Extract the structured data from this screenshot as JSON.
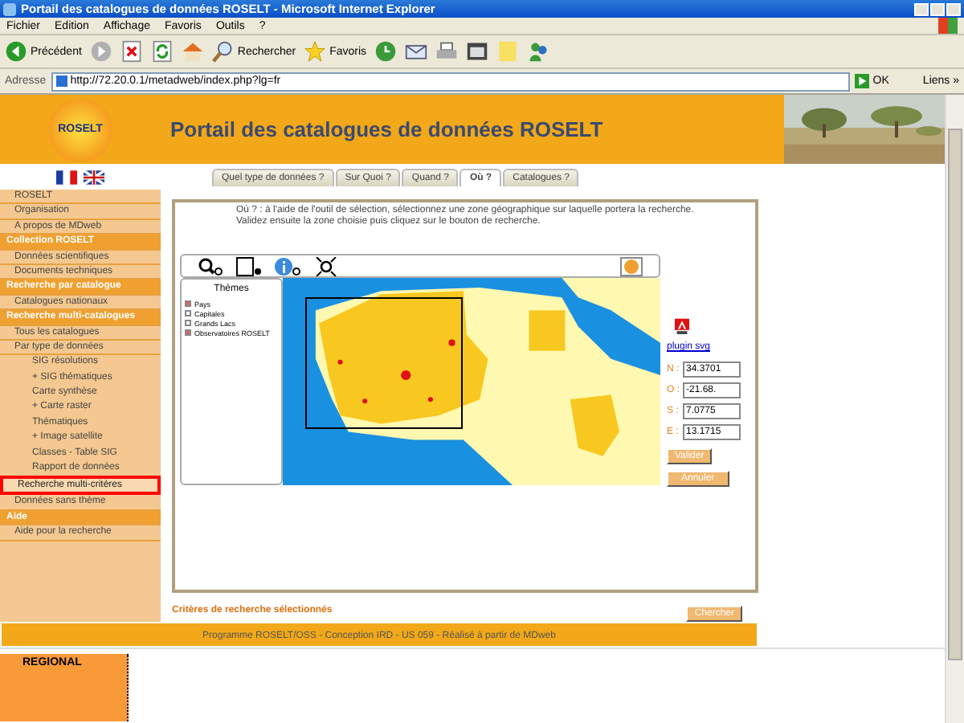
{
  "window": {
    "title": "Portail des catalogues de données ROSELT - Microsoft Internet Explorer"
  },
  "menu": [
    "Fichier",
    "Edition",
    "Affichage",
    "Favoris",
    "Outils",
    "?"
  ],
  "toolbar": [
    {
      "kind": "back",
      "label": "Précédent"
    },
    {
      "kind": "forward"
    },
    {
      "kind": "stop"
    },
    {
      "kind": "refresh"
    },
    {
      "kind": "home"
    },
    {
      "kind": "search",
      "label": "Rechercher"
    },
    {
      "kind": "favorites",
      "label": "Favoris"
    },
    {
      "kind": "history"
    },
    {
      "kind": "mail"
    },
    {
      "kind": "print"
    },
    {
      "kind": "edit"
    },
    {
      "kind": "folder"
    },
    {
      "kind": "messenger"
    }
  ],
  "address": {
    "label": "Adresse",
    "value": "http://72.20.0.1/metadweb/index.php?lg=fr",
    "go": "OK",
    "links": "Liens »"
  },
  "header": {
    "logo": "ROSELT",
    "title": "Portail des catalogues de données ROSELT"
  },
  "sidebar": [
    {
      "kind": "item",
      "label": "ROSELT",
      "selected": false
    },
    {
      "kind": "item",
      "label": "Organisation",
      "selected": false
    },
    {
      "kind": "item",
      "label": "A propos de MDweb",
      "selected": false
    },
    {
      "kind": "heading",
      "label": "Collection ROSELT"
    },
    {
      "kind": "item",
      "label": "Données scientifiques",
      "selected": false
    },
    {
      "kind": "item",
      "label": "Documents techniques",
      "selected": false
    },
    {
      "kind": "heading",
      "label": "Recherche par catalogue"
    },
    {
      "kind": "item",
      "label": "Catalogues nationaux",
      "selected": false
    },
    {
      "kind": "heading",
      "label": "Recherche multi-catalogues"
    },
    {
      "kind": "item",
      "label": "Tous les catalogues",
      "selected": false
    },
    {
      "kind": "item",
      "label": "Par type de données",
      "selected": false,
      "children": [
        {
          "label": "SIG résolutions",
          "selected": false
        },
        {
          "label": "+ SIG thématiques",
          "selected": false
        },
        {
          "label": "Carte synthèse",
          "selected": false
        },
        {
          "label": "+ Carte raster",
          "selected": false
        },
        {
          "label": "Thématiques",
          "selected": false
        },
        {
          "label": "+ Image satellite",
          "selected": false
        },
        {
          "label": "Classes - Table SIG",
          "selected": false
        },
        {
          "label": "Rapport de données",
          "selected": false
        }
      ]
    },
    {
      "kind": "item",
      "label": "Recherche multi-critères",
      "selected": true
    },
    {
      "kind": "item",
      "label": "Données sans thème",
      "selected": false
    },
    {
      "kind": "heading",
      "label": "Aide"
    },
    {
      "kind": "item",
      "label": "Aide pour la recherche",
      "selected": false
    }
  ],
  "tabs": [
    {
      "label": "Quel type de données ?",
      "selected": false
    },
    {
      "label": "Sur Quoi ?",
      "selected": false
    },
    {
      "label": "Quand ?",
      "selected": false
    },
    {
      "label": "Où ?",
      "selected": true
    },
    {
      "label": "Catalogues ?",
      "selected": false
    }
  ],
  "instruction": "Où ? : à l'aide de l'outil de sélection, sélectionnez une zone géographique sur laquelle portera la recherche. Validez ensuite la zone choisie puis cliquez sur le bouton de recherche.",
  "themes": {
    "title": "Thèmes",
    "items": [
      {
        "label": "Pays",
        "checked": true
      },
      {
        "label": "Capitales",
        "checked": false
      },
      {
        "label": "Grands Lacs",
        "checked": false
      },
      {
        "label": "Observatoires ROSELT",
        "checked": true
      }
    ]
  },
  "plugin_link": "plugin svg",
  "coords": [
    {
      "label": "N :",
      "value": "34.3701"
    },
    {
      "label": "O :",
      "value": "-21.68."
    },
    {
      "label": "S :",
      "value": "7.0775"
    },
    {
      "label": "E :",
      "value": "13.1715"
    }
  ],
  "buttons": [
    "Valider",
    "Annuler"
  ],
  "criteria": {
    "title": "Critères de recherche sélectionnés",
    "search": "Chercher"
  },
  "footer": "Programme ROSELT/OSS - Conception IRD - US 059 - Réalisé à partir de MDweb",
  "below": "REGIONAL"
}
